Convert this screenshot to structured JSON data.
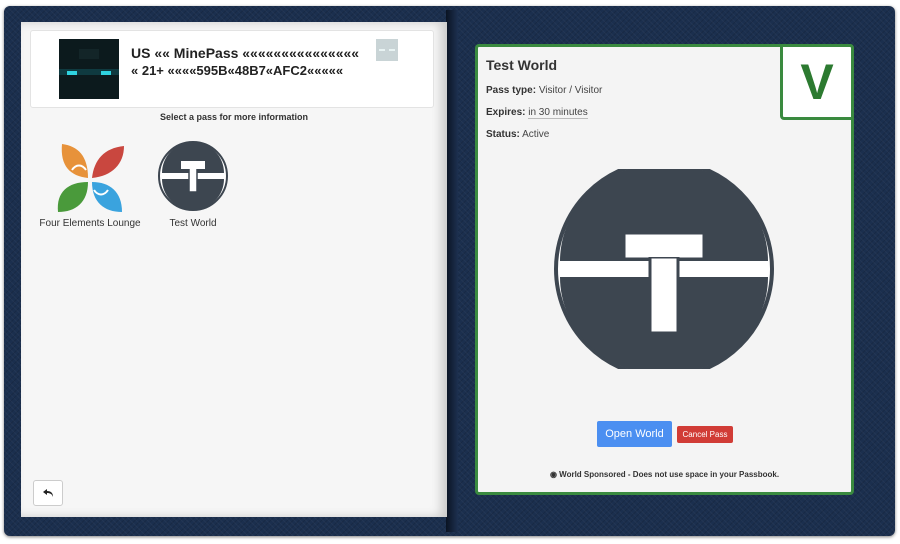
{
  "left": {
    "header": {
      "title": "US «« MinePass «««««««««««««««",
      "code": "« 21+ ««««595B«48B7«AFC2«««««"
    },
    "select_hint": "Select a pass for more information",
    "passes": [
      {
        "label": "Four Elements Lounge",
        "icon": "four-elements-logo"
      },
      {
        "label": "Test World",
        "icon": "test-world-logo"
      }
    ],
    "back_icon": "reply-arrow-icon"
  },
  "detail": {
    "title": "Test World",
    "pass_type_label": "Pass type:",
    "pass_type_value": "Visitor / Visitor",
    "expires_label": "Expires:",
    "expires_value": "in 30 minutes",
    "status_label": "Status:",
    "status_value": "Active",
    "badge": "V",
    "open_button": "Open World",
    "cancel_button": "Cancel Pass",
    "footer_note": "World Sponsored - Does not use space in your Passbook.",
    "footer_icon": "globe-icon"
  },
  "colors": {
    "accent_green": "#3a8a3f",
    "open_blue": "#4b8ff1",
    "cancel_red": "#d13c36",
    "logo_dark": "#3d4650",
    "background": "#1b2f4e"
  }
}
